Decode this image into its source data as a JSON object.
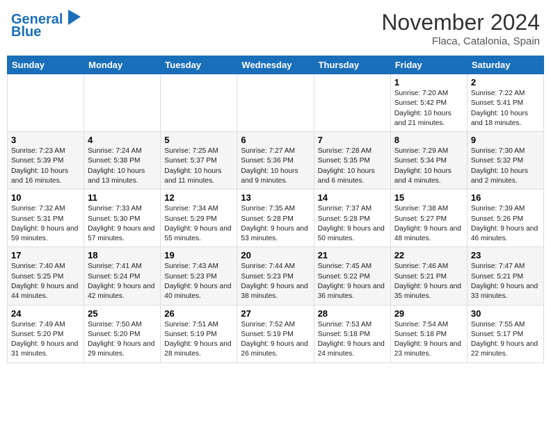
{
  "header": {
    "logo_line1": "General",
    "logo_line2": "Blue",
    "month": "November 2024",
    "location": "Flaca, Catalonia, Spain"
  },
  "weekdays": [
    "Sunday",
    "Monday",
    "Tuesday",
    "Wednesday",
    "Thursday",
    "Friday",
    "Saturday"
  ],
  "weeks": [
    [
      {
        "day": "",
        "info": ""
      },
      {
        "day": "",
        "info": ""
      },
      {
        "day": "",
        "info": ""
      },
      {
        "day": "",
        "info": ""
      },
      {
        "day": "",
        "info": ""
      },
      {
        "day": "1",
        "info": "Sunrise: 7:20 AM\nSunset: 5:42 PM\nDaylight: 10 hours and 21 minutes."
      },
      {
        "day": "2",
        "info": "Sunrise: 7:22 AM\nSunset: 5:41 PM\nDaylight: 10 hours and 18 minutes."
      }
    ],
    [
      {
        "day": "3",
        "info": "Sunrise: 7:23 AM\nSunset: 5:39 PM\nDaylight: 10 hours and 16 minutes."
      },
      {
        "day": "4",
        "info": "Sunrise: 7:24 AM\nSunset: 5:38 PM\nDaylight: 10 hours and 13 minutes."
      },
      {
        "day": "5",
        "info": "Sunrise: 7:25 AM\nSunset: 5:37 PM\nDaylight: 10 hours and 11 minutes."
      },
      {
        "day": "6",
        "info": "Sunrise: 7:27 AM\nSunset: 5:36 PM\nDaylight: 10 hours and 9 minutes."
      },
      {
        "day": "7",
        "info": "Sunrise: 7:28 AM\nSunset: 5:35 PM\nDaylight: 10 hours and 6 minutes."
      },
      {
        "day": "8",
        "info": "Sunrise: 7:29 AM\nSunset: 5:34 PM\nDaylight: 10 hours and 4 minutes."
      },
      {
        "day": "9",
        "info": "Sunrise: 7:30 AM\nSunset: 5:32 PM\nDaylight: 10 hours and 2 minutes."
      }
    ],
    [
      {
        "day": "10",
        "info": "Sunrise: 7:32 AM\nSunset: 5:31 PM\nDaylight: 9 hours and 59 minutes."
      },
      {
        "day": "11",
        "info": "Sunrise: 7:33 AM\nSunset: 5:30 PM\nDaylight: 9 hours and 57 minutes."
      },
      {
        "day": "12",
        "info": "Sunrise: 7:34 AM\nSunset: 5:29 PM\nDaylight: 9 hours and 55 minutes."
      },
      {
        "day": "13",
        "info": "Sunrise: 7:35 AM\nSunset: 5:28 PM\nDaylight: 9 hours and 53 minutes."
      },
      {
        "day": "14",
        "info": "Sunrise: 7:37 AM\nSunset: 5:28 PM\nDaylight: 9 hours and 50 minutes."
      },
      {
        "day": "15",
        "info": "Sunrise: 7:38 AM\nSunset: 5:27 PM\nDaylight: 9 hours and 48 minutes."
      },
      {
        "day": "16",
        "info": "Sunrise: 7:39 AM\nSunset: 5:26 PM\nDaylight: 9 hours and 46 minutes."
      }
    ],
    [
      {
        "day": "17",
        "info": "Sunrise: 7:40 AM\nSunset: 5:25 PM\nDaylight: 9 hours and 44 minutes."
      },
      {
        "day": "18",
        "info": "Sunrise: 7:41 AM\nSunset: 5:24 PM\nDaylight: 9 hours and 42 minutes."
      },
      {
        "day": "19",
        "info": "Sunrise: 7:43 AM\nSunset: 5:23 PM\nDaylight: 9 hours and 40 minutes."
      },
      {
        "day": "20",
        "info": "Sunrise: 7:44 AM\nSunset: 5:23 PM\nDaylight: 9 hours and 38 minutes."
      },
      {
        "day": "21",
        "info": "Sunrise: 7:45 AM\nSunset: 5:22 PM\nDaylight: 9 hours and 36 minutes."
      },
      {
        "day": "22",
        "info": "Sunrise: 7:46 AM\nSunset: 5:21 PM\nDaylight: 9 hours and 35 minutes."
      },
      {
        "day": "23",
        "info": "Sunrise: 7:47 AM\nSunset: 5:21 PM\nDaylight: 9 hours and 33 minutes."
      }
    ],
    [
      {
        "day": "24",
        "info": "Sunrise: 7:49 AM\nSunset: 5:20 PM\nDaylight: 9 hours and 31 minutes."
      },
      {
        "day": "25",
        "info": "Sunrise: 7:50 AM\nSunset: 5:20 PM\nDaylight: 9 hours and 29 minutes."
      },
      {
        "day": "26",
        "info": "Sunrise: 7:51 AM\nSunset: 5:19 PM\nDaylight: 9 hours and 28 minutes."
      },
      {
        "day": "27",
        "info": "Sunrise: 7:52 AM\nSunset: 5:19 PM\nDaylight: 9 hours and 26 minutes."
      },
      {
        "day": "28",
        "info": "Sunrise: 7:53 AM\nSunset: 5:18 PM\nDaylight: 9 hours and 24 minutes."
      },
      {
        "day": "29",
        "info": "Sunrise: 7:54 AM\nSunset: 5:18 PM\nDaylight: 9 hours and 23 minutes."
      },
      {
        "day": "30",
        "info": "Sunrise: 7:55 AM\nSunset: 5:17 PM\nDaylight: 9 hours and 22 minutes."
      }
    ]
  ]
}
